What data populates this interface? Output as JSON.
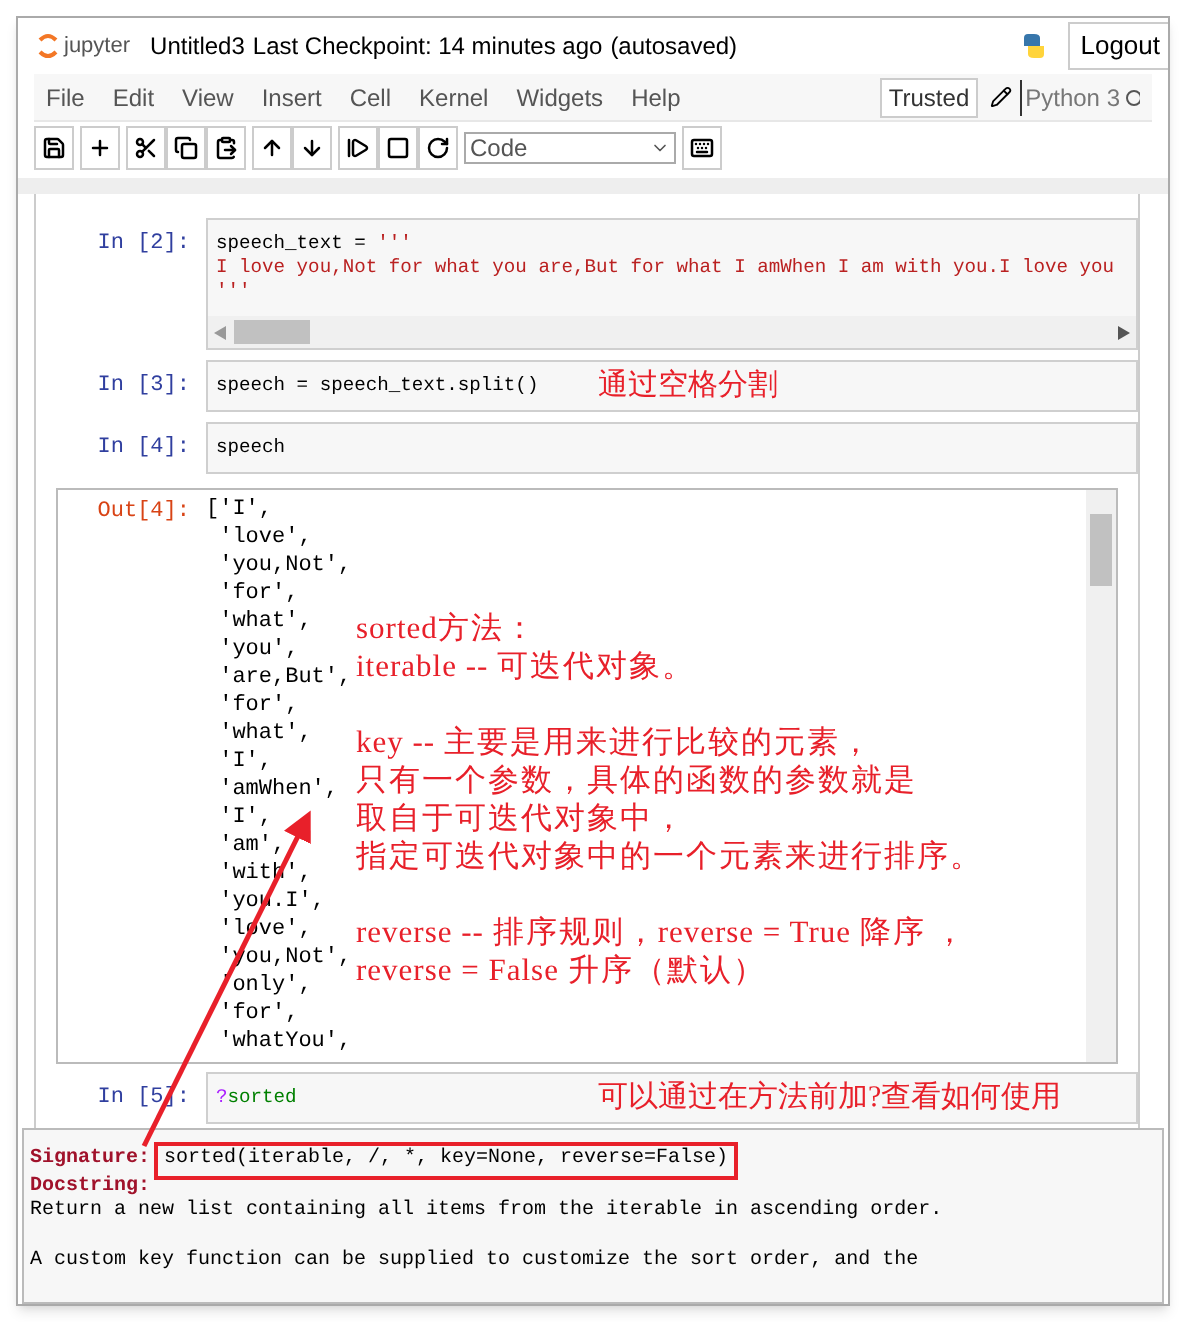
{
  "header": {
    "logo_text": "jupyter",
    "notebook_name": "Untitled3",
    "checkpoint": "Last Checkpoint: 14 minutes ago",
    "autosave": "(autosaved)",
    "logout": "Logout"
  },
  "menu": [
    "File",
    "Edit",
    "View",
    "Insert",
    "Cell",
    "Kernel",
    "Widgets",
    "Help"
  ],
  "trusted": "Trusted",
  "kernel": "Python 3",
  "cell_type": "Code",
  "cells": [
    {
      "prompt": "In [2]:",
      "lines": [
        [
          {
            "text": "speech_text = ",
            "kind": "plain"
          },
          {
            "text": "'''",
            "kind": "string"
          }
        ],
        [
          {
            "text": "I love you,Not for what you are,But for what I amWhen I am with you.I love you",
            "kind": "string"
          }
        ],
        [
          {
            "text": "'''",
            "kind": "string"
          }
        ]
      ],
      "hscroll": true
    },
    {
      "prompt": "In [3]:",
      "lines": [
        [
          {
            "text": "speech = speech_text.split()",
            "kind": "plain"
          }
        ]
      ],
      "note": "通过空格分割"
    },
    {
      "prompt": "In [4]:",
      "lines": [
        [
          {
            "text": "speech",
            "kind": "plain"
          }
        ]
      ],
      "output": {
        "prompt": "Out[4]:",
        "lines": [
          "['I',",
          " 'love',",
          " 'you,Not',",
          " 'for',",
          " 'what',",
          " 'you',",
          " 'are,But',",
          " 'for',",
          " 'what',",
          " 'I',",
          " 'amWhen',",
          " 'I',",
          " 'am',",
          " 'with',",
          " 'you.I',",
          " 'love',",
          " 'you,Not',",
          " 'only',",
          " 'for',",
          " 'whatYou',"
        ]
      }
    },
    {
      "prompt": "In [5]:",
      "lines": [
        [
          {
            "text": "?",
            "kind": "magic"
          },
          {
            "text": "sorted",
            "kind": "builtin"
          }
        ]
      ],
      "note": "可以通过在方法前加?查看如何使用"
    }
  ],
  "annotation": [
    [
      "sorted方法：",
      "iterable -- 可迭代对象。"
    ],
    [
      "key -- 主要是用来进行比较的元素，",
      "只有一个参数，具体的函数的参数就是",
      "取自于可迭代对象中，",
      "指定可迭代对象中的一个元素来进行排序。"
    ],
    [
      "reverse -- 排序规则，reverse = True 降序 ，",
      "reverse = False 升序（默认）"
    ]
  ],
  "pager": {
    "signature_label": "Signature:",
    "signature": "sorted(iterable, /, *, key=None, reverse=False)",
    "docstring_label": "Docstring:",
    "paragraphs": [
      [
        "Return a new list containing all items from the iterable in ascending order."
      ],
      [
        "A custom key function can be supplied to customize the sort order, and the"
      ]
    ]
  }
}
